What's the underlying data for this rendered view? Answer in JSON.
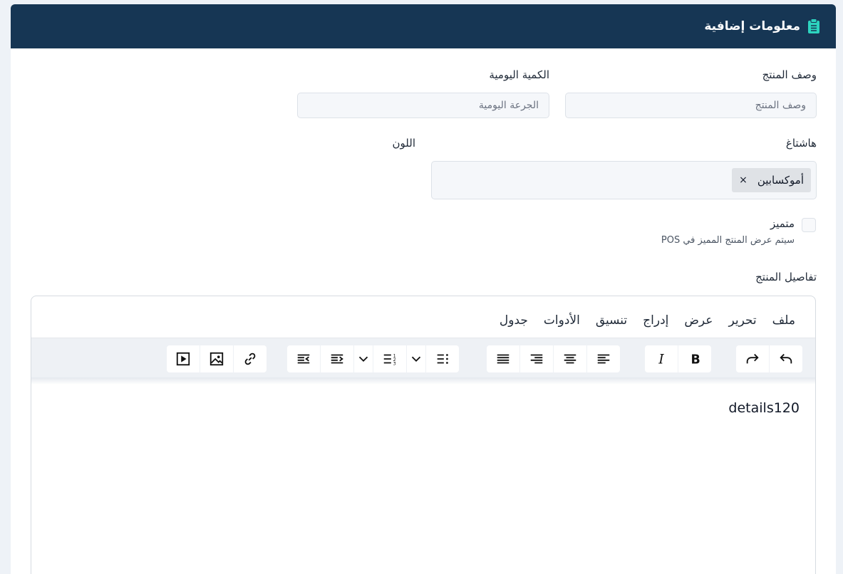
{
  "header": {
    "title": "معلومات إضافية",
    "icon": "clipboard-icon",
    "icon_color": "#2dd4bf"
  },
  "fields": {
    "product_description": {
      "label": "وصف المنتج",
      "placeholder": "وصف المنتج"
    },
    "daily_quantity": {
      "label": "الكمية اليومية",
      "placeholder": "الجرعة اليومية"
    },
    "hashtag": {
      "label": "هاشتاغ",
      "tags": [
        "أموكسابين"
      ],
      "remove_symbol": "×"
    },
    "color": {
      "label": "اللون"
    },
    "featured": {
      "label": "متميز",
      "checked": false,
      "hint": "سيتم عرض المنتج المميز في POS"
    },
    "details": {
      "label": "تفاصيل المنتج"
    }
  },
  "editor": {
    "menu": [
      "ملف",
      "تحرير",
      "عرض",
      "إدراج",
      "تنسيق",
      "الأدوات",
      "جدول"
    ],
    "toolbar_groups": [
      [
        "undo-icon",
        "redo-icon"
      ],
      [
        "bold-icon",
        "italic-icon"
      ],
      [
        "align-left-icon",
        "align-center-icon",
        "align-right-icon",
        "align-justify-icon"
      ],
      [
        "bullet-list-icon",
        "bullet-list-dropdown-icon",
        "numbered-list-icon",
        "numbered-list-dropdown-icon",
        "indent-icon",
        "outdent-icon"
      ],
      [
        "link-icon",
        "image-icon",
        "media-icon"
      ]
    ],
    "content": "details120"
  },
  "colors": {
    "header_bg": "#163654",
    "page_bg": "#eef2f7",
    "toolbar_bg": "#eef1f5"
  }
}
